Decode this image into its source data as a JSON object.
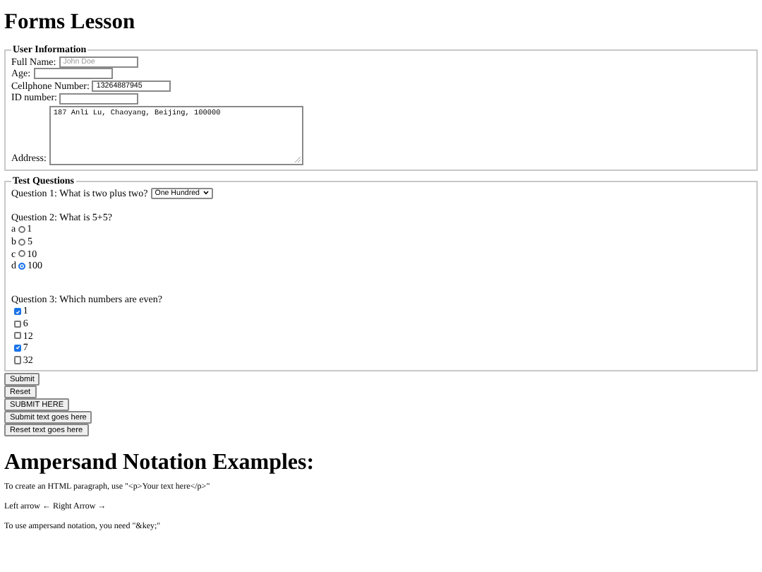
{
  "title": "Forms Lesson",
  "user_information": {
    "legend": "User Information",
    "fields": [
      {
        "label": "Full Name:",
        "placeholder": "John Doe"
      },
      {
        "label": "Age:"
      },
      {
        "label": "Cellphone Number:",
        "value": "13264887945"
      },
      {
        "label": "ID number:"
      }
    ],
    "address": {
      "label": "Address:",
      "value": "187 Anli Lu, Chaoyang, Beijing, 100000"
    }
  },
  "test_questions": {
    "legend": "Test Questions",
    "question_1": {
      "label": "Question 1: What is two plus two?",
      "value": "One Hundred"
    },
    "question_2": {
      "label": "Question 2: What is 5+5?",
      "options": [
        {
          "letter": "a",
          "label": "1",
          "selected": false
        },
        {
          "letter": "b",
          "label": "5",
          "selected": false
        },
        {
          "letter": "c",
          "label": "10",
          "selected": false
        },
        {
          "letter": "d",
          "label": "100",
          "selected": true
        }
      ]
    },
    "question_3": {
      "label": "Question 3: Which numbers are even?",
      "options": [
        {
          "label": "1",
          "checked": true
        },
        {
          "label": "6",
          "checked": false
        },
        {
          "label": "12",
          "checked": false
        },
        {
          "label": "7",
          "checked": true
        },
        {
          "label": "32",
          "checked": false
        }
      ]
    }
  },
  "buttons": [
    "Submit",
    "Reset",
    "SUBMIT HERE",
    "Submit text goes here",
    "Reset text goes here"
  ],
  "heading": "Ampersand Notation Examples:",
  "paragraphs": [
    "To create an HTML paragraph, use \"<p>Your text here</p>\"",
    "Left arrow ← Right Arrow →",
    "To use ampersand notation, you need \"&key;\""
  ]
}
